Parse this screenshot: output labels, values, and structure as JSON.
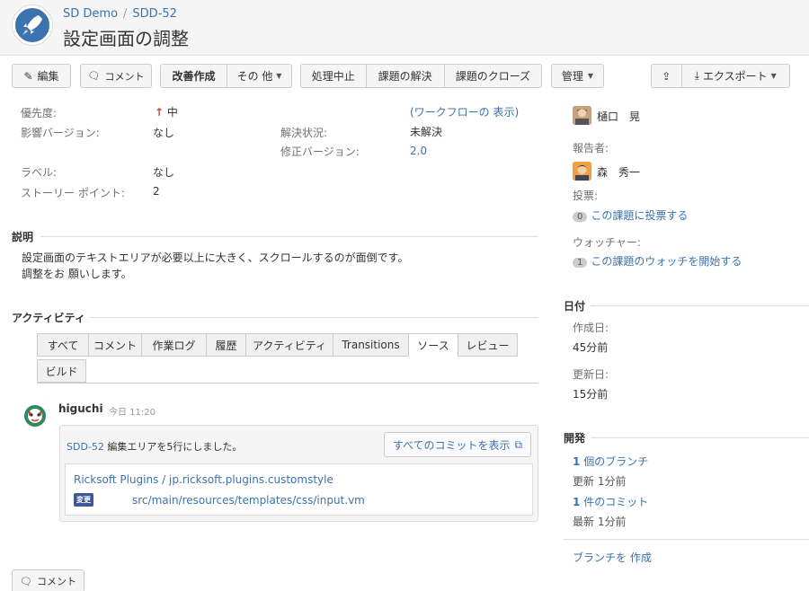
{
  "header": {
    "breadcrumb_project": "SD Demo",
    "breadcrumb_sep": "/",
    "breadcrumb_issue": "SDD-52",
    "title": "設定画面の調整"
  },
  "toolbar": {
    "edit": "編集",
    "comment": "コメント",
    "improve": "改善作成",
    "other": "その 他",
    "stop": "処理中止",
    "resolve": "課題の解決",
    "close": "課題のクローズ",
    "admin": "管理",
    "export": "エクスポート"
  },
  "details": {
    "priority_label": "優先度:",
    "priority_value": "中",
    "affects_label": "影響バージョン:",
    "affects_value": "なし",
    "workflow_link": "(ワークフローの 表示)",
    "resolution_label": "解決状況:",
    "resolution_value": "未解決",
    "fix_label": "修正バージョン:",
    "fix_value": "2.0",
    "labels_label": "ラベル:",
    "labels_value": "なし",
    "story_label": "ストーリー ポイント:",
    "story_value": "2"
  },
  "description": {
    "heading": "説明",
    "line1": "設定画面のテキストエリアが必要以上に大きく、スクロールするのが面倒です。",
    "line2": "調整をお 願いします。"
  },
  "activity": {
    "heading": "アクティビティ",
    "tabs": [
      "すべて",
      "コメント",
      "作業ログ",
      "履歴",
      "アクティビティ",
      "Transitions",
      "ソース",
      "レビュー",
      "ビルド"
    ],
    "active_tab": "ソース",
    "user": "higuchi",
    "time": "今日 11:20",
    "commit_issue": "SDD-52",
    "commit_msg": "編集エリアを5行にしました。",
    "all_commits": "すべてのコミットを表示",
    "repo": "Ricksoft Plugins / jp.ricksoft.plugins.customstyle",
    "change_badge": "変更",
    "file": "src/main/resources/templates/css/input.vm"
  },
  "bottom": {
    "comment": "コメント"
  },
  "people": {
    "assignee": "樋口　晃",
    "reporter_label": "報告者:",
    "reporter": "森　秀一",
    "votes_label": "投票:",
    "votes_count": "0",
    "votes_link": "この課題に投票する",
    "watchers_label": "ウォッチャー:",
    "watchers_count": "1",
    "watchers_link": "この課題のウォッチを開始する"
  },
  "dates": {
    "heading": "日付",
    "created_label": "作成日:",
    "created": "45分前",
    "updated_label": "更新日:",
    "updated": "15分前"
  },
  "dev": {
    "heading": "開発",
    "branch_count": "1",
    "branch_text": "個のブランチ",
    "branch_updated": "更新 1分前",
    "commit_count": "1",
    "commit_text": "件のコミット",
    "commit_latest": "最新 1分前",
    "create_branch": "ブランチを 作成"
  },
  "colors": {
    "link": "#3b73af",
    "priority_arrow": "#d04437"
  }
}
